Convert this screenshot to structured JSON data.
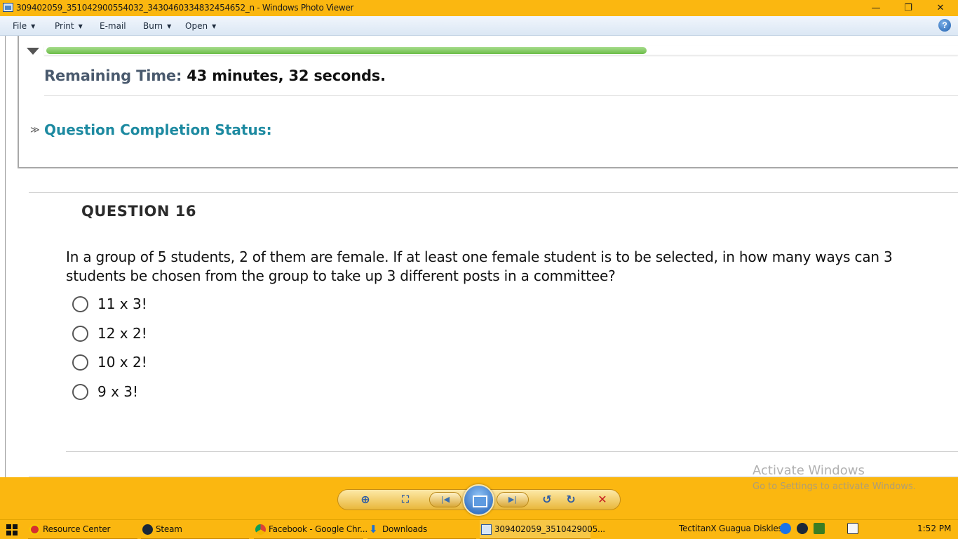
{
  "window": {
    "title": "309402059_351042900554032_3430460334832454652_n - Windows Photo Viewer",
    "minimize_glyph": "—",
    "restore_glyph": "❐",
    "close_glyph": "✕"
  },
  "menubar": {
    "file": "File",
    "print": "Print",
    "email": "E-mail",
    "burn": "Burn",
    "open": "Open",
    "help": "?"
  },
  "photo": {
    "remaining_label": "Remaining Time:",
    "remaining_value": " 43 minutes, 32 seconds.",
    "progress_fraction": 0.66,
    "qcs_chevron": "≫",
    "qcs_label": "Question Completion Status:",
    "question_title": "QUESTION 16",
    "question_text": "In a group of 5 students, 2 of them are female. If at least one female student is to be selected, in how many ways can 3 students be chosen from the group to take up 3 different posts in a committee?",
    "options": [
      "11 x 3!",
      "12 x 2!",
      "10 x 2!",
      "9 x 3!"
    ],
    "watermark_title": "Activate Windows",
    "watermark_sub": "Go to Settings to activate Windows."
  },
  "toolbar": {
    "zoom": "⊕",
    "fit": "⛶",
    "prev": "|◀",
    "next": "▶|",
    "rotate_ccw": "↺",
    "rotate_cw": "↻",
    "delete": "✕"
  },
  "taskbar": {
    "items": [
      {
        "label": "Resource Center",
        "icon": "resource-center-icon",
        "color": "#d62f2f"
      },
      {
        "label": "Steam",
        "icon": "steam-icon",
        "color": "#1b2838"
      },
      {
        "label": "Facebook - Google Chr...",
        "icon": "chrome-icon",
        "color": "#db4437"
      },
      {
        "label": "Downloads",
        "icon": "download-arrow-icon",
        "color": "#1f6fd1"
      },
      {
        "label": "309402059_3510429005...",
        "icon": "photo-viewer-icon",
        "color": "#2a5aa5"
      }
    ],
    "tray_label": "TectitanX Guagua Diskless",
    "clock": "1:52 PM"
  }
}
